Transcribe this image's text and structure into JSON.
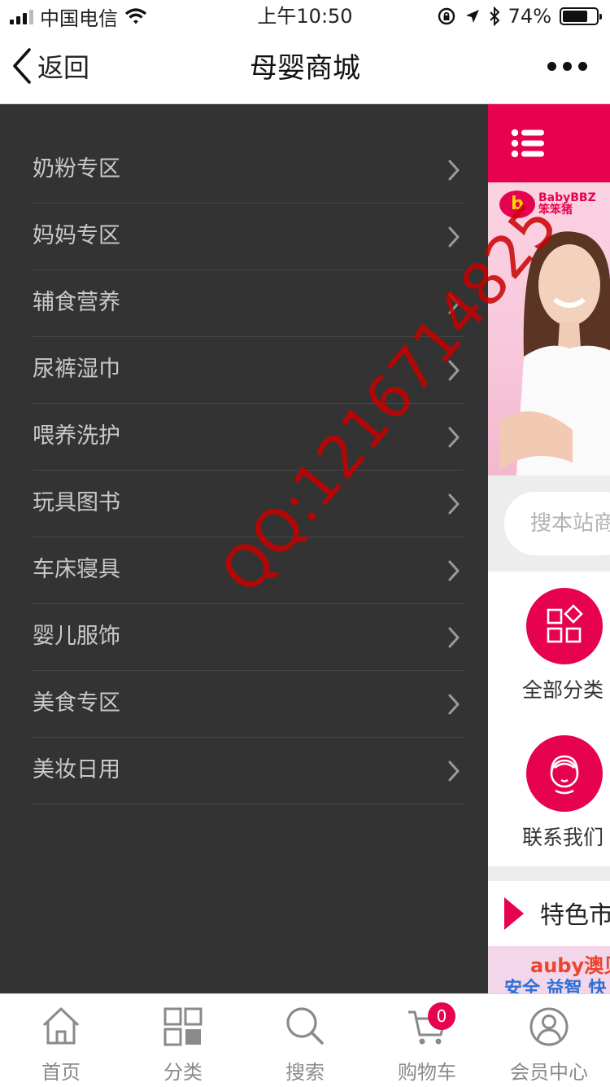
{
  "status_bar": {
    "carrier": "中国电信",
    "time": "上午10:50",
    "battery_percent": "74%",
    "battery_level": 0.74
  },
  "navbar": {
    "back_label": "返回",
    "title": "母婴商城"
  },
  "drawer": {
    "items": [
      {
        "label": "奶粉专区"
      },
      {
        "label": "妈妈专区"
      },
      {
        "label": "辅食营养"
      },
      {
        "label": "尿裤湿巾"
      },
      {
        "label": "喂养洗护"
      },
      {
        "label": "玩具图书"
      },
      {
        "label": "车床寝具"
      },
      {
        "label": "婴儿服饰"
      },
      {
        "label": "美食专区"
      },
      {
        "label": "美妆日用"
      }
    ]
  },
  "content": {
    "brand_name": "BabyBBZ",
    "brand_cn": "笨笨猪",
    "search_placeholder": "搜本站商",
    "quick_links": [
      {
        "label": "全部分类",
        "icon": "grid-diamond-icon"
      },
      {
        "label": "联系我们",
        "icon": "customer-service-icon"
      }
    ],
    "feature_title": "特色市",
    "feature_banner_brand": "auby澳贝",
    "feature_banner_text": "安全 益智 快"
  },
  "tabbar": {
    "tabs": [
      {
        "label": "首页",
        "icon": "home-icon"
      },
      {
        "label": "分类",
        "icon": "category-icon"
      },
      {
        "label": "搜索",
        "icon": "search-icon"
      },
      {
        "label": "购物车",
        "icon": "cart-icon"
      },
      {
        "label": "会员中心",
        "icon": "user-icon"
      }
    ],
    "cart_badge": "0"
  },
  "watermark": "QQ:1216714825",
  "colors": {
    "accent": "#e6024f",
    "drawer_bg": "#333333",
    "drawer_text": "#c9c9c9"
  }
}
